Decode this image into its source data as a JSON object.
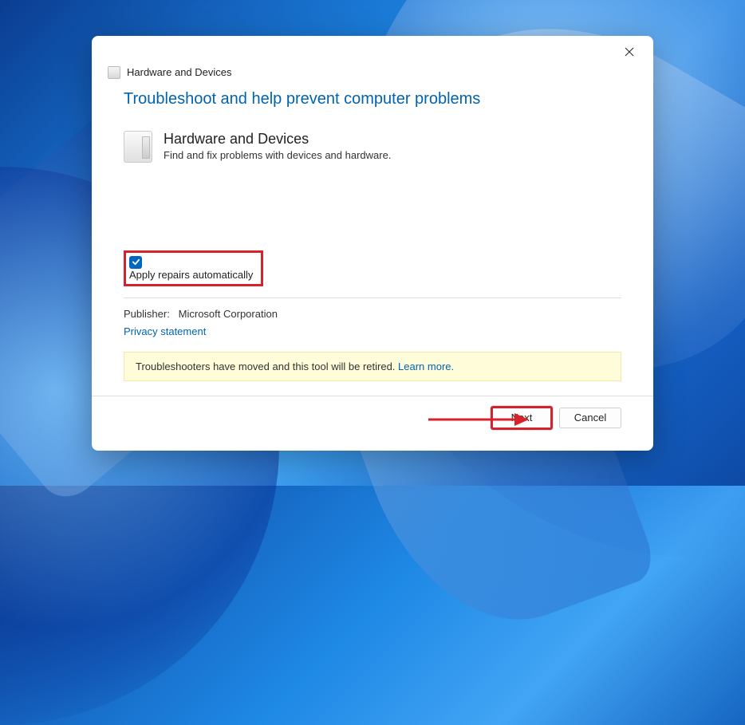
{
  "window": {
    "header_label": "Hardware and Devices"
  },
  "main": {
    "title": "Troubleshoot and help prevent computer problems",
    "device_title": "Hardware and Devices",
    "device_desc": "Find and fix problems with devices and hardware."
  },
  "options": {
    "apply_repairs_label": "Apply repairs automatically",
    "apply_repairs_checked": true
  },
  "footer": {
    "publisher_label": "Publisher:",
    "publisher_value": "Microsoft Corporation",
    "privacy_link": "Privacy statement"
  },
  "notice": {
    "text": "Troubleshooters have moved and this tool will be retired. ",
    "learn_more": "Learn more."
  },
  "buttons": {
    "next": "Next",
    "cancel": "Cancel"
  }
}
